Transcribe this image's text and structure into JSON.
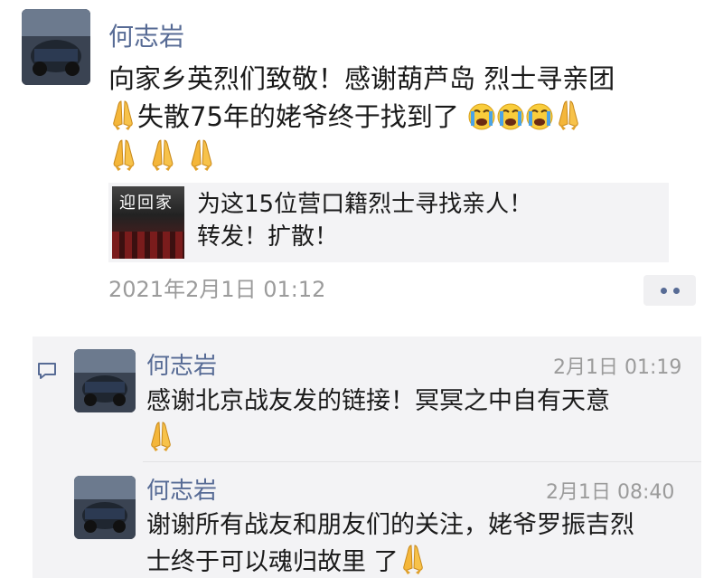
{
  "post": {
    "author": "何志岩",
    "text_line1": "向家乡英烈们致敬！感谢葫芦岛 烈士寻亲团",
    "text_line2": "失散75年的姥爷终于找到了",
    "link": {
      "title_line1": "为这15位营口籍烈士寻找亲人！",
      "title_line2": "转发！扩散！",
      "thumbnail_text": "迎回家"
    },
    "timestamp": "2021年2月1日 01:12",
    "emojis": [
      "folded-hands",
      "crying-face",
      "crying-face",
      "crying-face",
      "folded-hands",
      "folded-hands",
      "folded-hands",
      "folded-hands"
    ]
  },
  "comments": [
    {
      "author": "何志岩",
      "time": "2月1日 01:19",
      "text": "感谢北京战友发的链接！冥冥之中自有天意"
    },
    {
      "author": "何志岩",
      "time": "2月1日 08:40",
      "text_line1": "谢谢所有战友和朋友们的关注，姥爷罗振吉烈",
      "text_line2": "士终于可以魂归故里 了"
    }
  ],
  "colors": {
    "name": "#576b95",
    "timestamp": "#9b9b9b",
    "comment_bg": "#f3f3f5"
  }
}
